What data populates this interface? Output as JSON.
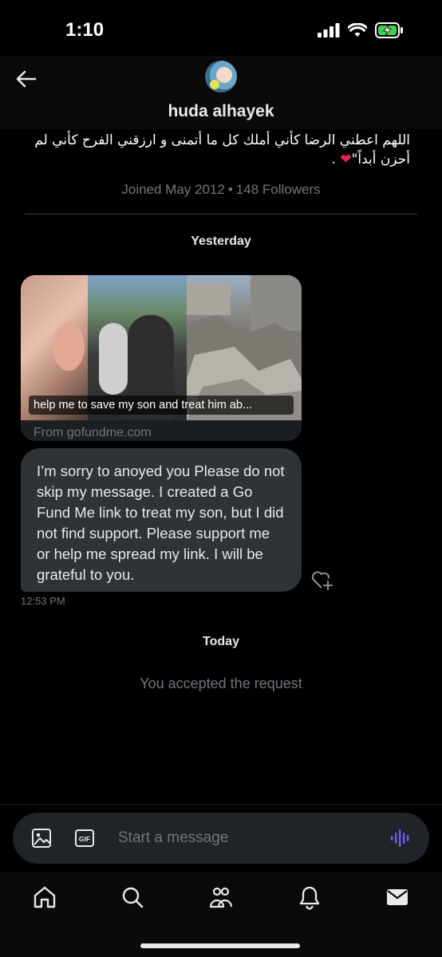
{
  "status_bar": {
    "time": "1:10",
    "icons": [
      "signal-icon",
      "wifi-icon",
      "battery-charging-icon"
    ]
  },
  "header": {
    "back_icon": "arrow-left-icon",
    "name": "huda alhayek"
  },
  "profile": {
    "bio": "اللهم اعطني الرضا كأني أملك كل ما أتمنى و ارزقني الفرح كأني لم أحزن أبداً\"",
    "bio_end": ".",
    "joined": "Joined May 2012",
    "followers": "148 Followers"
  },
  "conversation": {
    "day_1": "Yesterday",
    "link_card": {
      "caption": "help me to save my son and treat him ab...",
      "domain": "From gofundme.com"
    },
    "message": {
      "text": "I’m sorry to anoyed you Please do not skip  my message. I created a Go Fund Me link to treat my son, but I did not find support. Please support me or help me spread my link. I will be grateful to you.",
      "time": "12:53 PM"
    },
    "day_2": "Today",
    "system_note": "You accepted the request"
  },
  "composer": {
    "placeholder": "Start a message"
  },
  "nav": {
    "items": [
      "home-icon",
      "search-icon",
      "communities-icon",
      "notifications-icon",
      "messages-icon"
    ]
  },
  "colors": {
    "accent": "#7856ff",
    "heart": "#e0245e",
    "bubble": "#2f3336",
    "muted": "#71767b"
  }
}
